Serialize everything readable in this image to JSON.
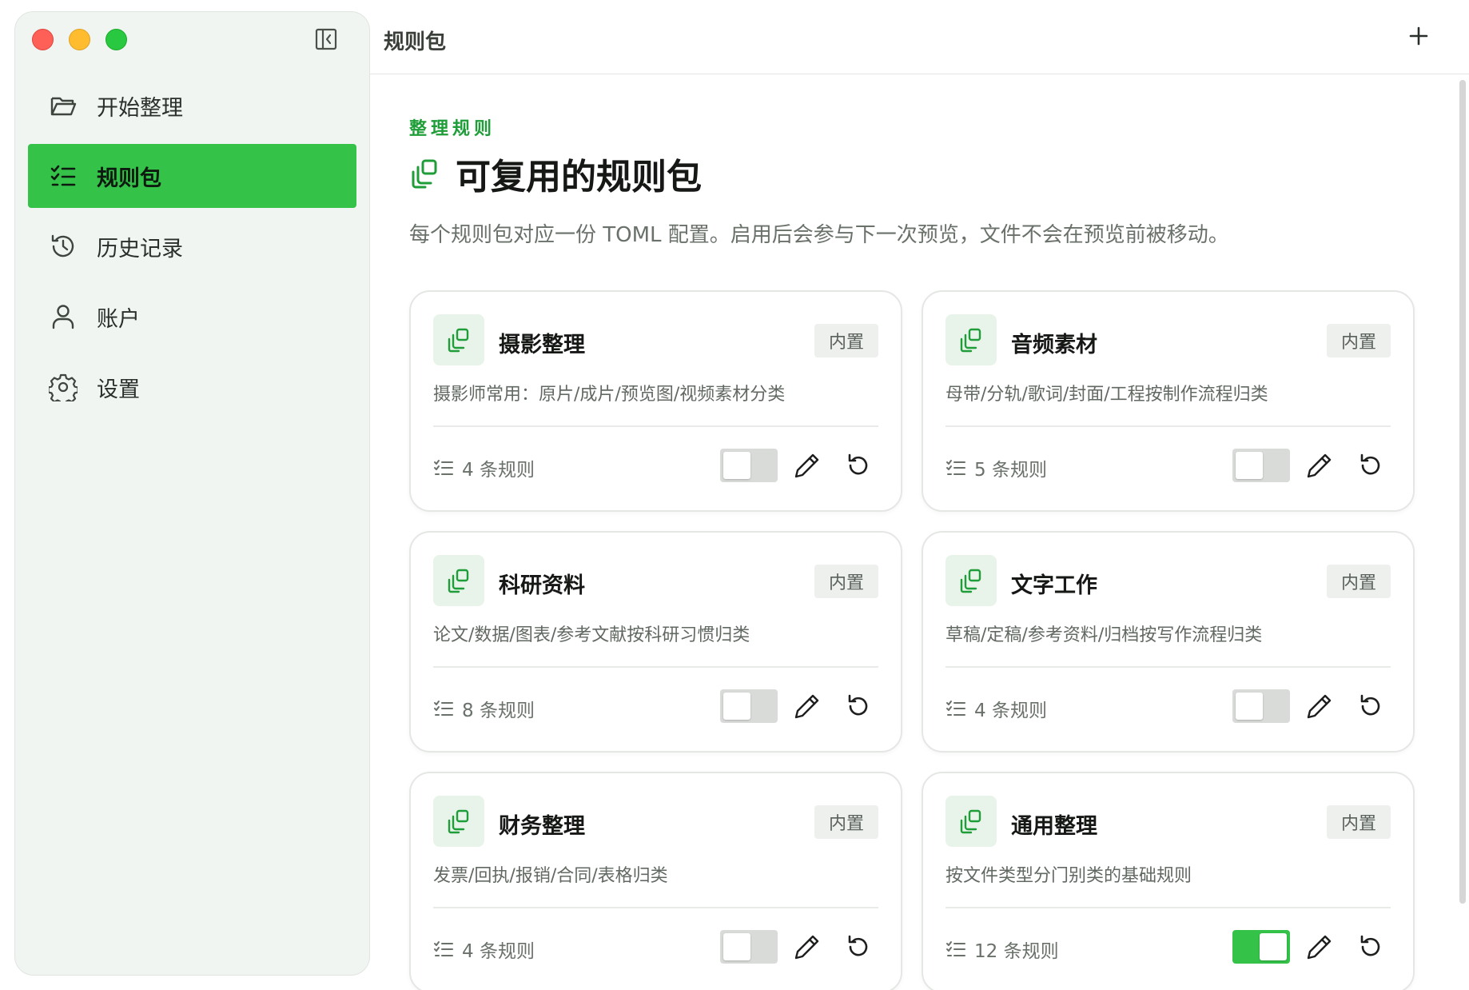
{
  "sidebar": {
    "items": [
      {
        "label": "开始整理",
        "icon": "folder-open-icon",
        "active": false
      },
      {
        "label": "规则包",
        "icon": "list-check-icon",
        "active": true
      },
      {
        "label": "历史记录",
        "icon": "history-icon",
        "active": false
      },
      {
        "label": "账户",
        "icon": "user-icon",
        "active": false
      },
      {
        "label": "设置",
        "icon": "gear-icon",
        "active": false
      }
    ]
  },
  "topbar": {
    "title": "规则包"
  },
  "main": {
    "eyebrow": "整理规则",
    "heading": "可复用的规则包",
    "description": "每个规则包对应一份 TOML 配置。启用后会参与下一次预览，文件不会在预览前被移动。"
  },
  "cards": [
    {
      "title": "摄影整理",
      "badge": "内置",
      "description": "摄影师常用：原片/成片/预览图/视频素材分类",
      "rules": "4 条规则",
      "enabled": false
    },
    {
      "title": "音频素材",
      "badge": "内置",
      "description": "母带/分轨/歌词/封面/工程按制作流程归类",
      "rules": "5 条规则",
      "enabled": false
    },
    {
      "title": "科研资料",
      "badge": "内置",
      "description": "论文/数据/图表/参考文献按科研习惯归类",
      "rules": "8 条规则",
      "enabled": false
    },
    {
      "title": "文字工作",
      "badge": "内置",
      "description": "草稿/定稿/参考资料/归档按写作流程归类",
      "rules": "4 条规则",
      "enabled": false
    },
    {
      "title": "财务整理",
      "badge": "内置",
      "description": "发票/回执/报销/合同/表格归类",
      "rules": "4 条规则",
      "enabled": false
    },
    {
      "title": "通用整理",
      "badge": "内置",
      "description": "按文件类型分门别类的基础规则",
      "rules": "12 条规则",
      "enabled": true
    }
  ],
  "colors": {
    "accent": "#34c249",
    "eyebrow": "#1e9d38",
    "sidebar_bg": "#f1f5f1"
  }
}
